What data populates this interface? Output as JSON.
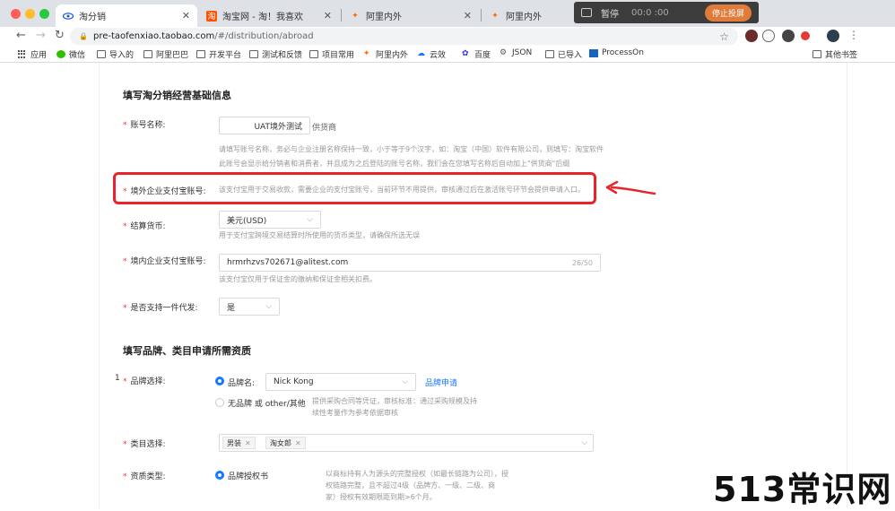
{
  "tabs": [
    {
      "title": "淘分销",
      "active": true
    },
    {
      "title": "淘宝网 - 淘！我喜欢",
      "active": false
    },
    {
      "title": "阿里内外",
      "active": false
    },
    {
      "title": "阿里内外",
      "active": false
    }
  ],
  "recording": {
    "label": "暂停",
    "time": "00:0 :00",
    "stop_label": "停止投屏"
  },
  "address_bar": {
    "host": "pre-taofenxiao.taobao.com",
    "path": "/#/distribution/abroad"
  },
  "bookmarks": [
    "应用",
    "微信",
    "导入的",
    "阿里巴巴",
    "开发平台",
    "测试和反馈",
    "项目常用",
    "阿里内外",
    "云效",
    "百度",
    "JSON",
    "已导入",
    "ProcessOn",
    "其他书签"
  ],
  "form": {
    "section1_title": "填写淘分销经营基础信息",
    "account_name": {
      "label": "账号名称:",
      "value": "UAT境外测试",
      "suffix": "供货商",
      "help_line1": "请填写账号名称，务必与企业注册名称保持一致，小于等于9个汉字，如：淘宝（中国）软件有限公司，则填写：淘宝软件",
      "help_line2": "此账号会显示给分销者和消费者，并且成为之后登陆的账号名称，我们会在您填写名称后自动加上\"供货商\"后缀"
    },
    "overseas_alipay": {
      "label": "境外企业支付宝账号:",
      "help": "该支付宝用于交易收款，需要企业的支付宝账号，当前环节不用提供，审核通过后在激活账号环节会提供申请入口。"
    },
    "currency": {
      "label": "结算货币:",
      "value": "美元(USD)",
      "help": "用于支付宝跨境交易结算时所使用的货币类型，请确保所选无误"
    },
    "domestic_alipay": {
      "label": "境内企业支付宝账号:",
      "value": "hrmrhzvs702671@alitest.com",
      "counter": "26/50",
      "help": "该支付宝仅用于保证金的缴纳和保证金相关扣费。"
    },
    "dropship": {
      "label": "是否支持一件代发:",
      "value": "是"
    },
    "section2_title": "填写品牌、类目申请所需资质",
    "row_index": "1",
    "brand": {
      "label": "品牌选择:",
      "option1": "品牌名:",
      "brand_value": "Nick Kong",
      "apply_link": "品牌申请",
      "option2": "无品牌 或 other/其他",
      "option2_help_line1": "提供采购合同等凭证，审核标准：通过采购规模及持",
      "option2_help_line2": "续性考量作为参考依据审核"
    },
    "category": {
      "label": "类目选择:",
      "tags": [
        "男装",
        "淘女郎"
      ]
    },
    "qualification": {
      "label": "资质类型:",
      "option": "品牌授权书",
      "help_line1": "以商标持有人为源头的完整授权（如最长链路为公司），授",
      "help_line2": "权链路完整，且不超过4级（品牌方、一级、二级、商",
      "help_line3": "家）授权有效期限距到期>6个月。"
    }
  },
  "watermark": "513常识网",
  "colors": {
    "accent": "#1677ff",
    "required": "#e53935",
    "highlight": "#e8232a"
  }
}
